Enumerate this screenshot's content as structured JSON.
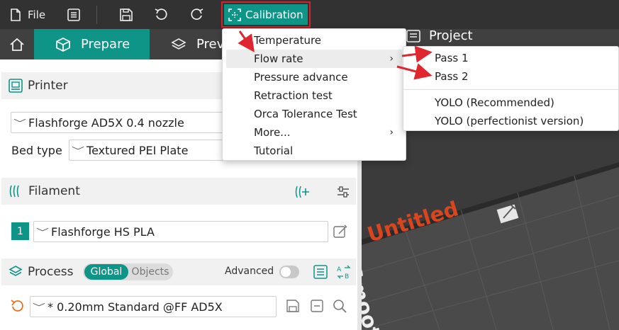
{
  "toolbar": {
    "file_label": "File",
    "calibration_label": "Calibration",
    "accent_color": "#0f9488",
    "highlight_color": "#d6222a"
  },
  "tabs": {
    "prepare_label": "Prepare",
    "preview_label": "Prev",
    "project_label": "Project"
  },
  "printer": {
    "section_title": "Printer",
    "preset": "Flashforge AD5X 0.4 nozzle",
    "bed_type_label": "Bed type",
    "bed_type_value": "Textured PEI Plate"
  },
  "filament": {
    "section_title": "Filament",
    "slot_number": "1",
    "preset": "Flashforge HS PLA"
  },
  "process": {
    "section_title": "Process",
    "global_label": "Global",
    "objects_label": "Objects",
    "advanced_label": "Advanced",
    "preset": "* 0.20mm Standard @FF AD5X"
  },
  "viewport": {
    "plate_name": "Untitled",
    "bed_text": "Smoot"
  },
  "calibration_menu": {
    "items": [
      {
        "label": "Temperature"
      },
      {
        "label": "Flow rate",
        "has_submenu": true
      },
      {
        "label": "Pressure advance"
      },
      {
        "label": "Retraction test"
      },
      {
        "label": "Orca Tolerance Test"
      },
      {
        "label": "More...",
        "has_submenu": true
      },
      {
        "label": "Tutorial"
      }
    ],
    "submenu_arrow": "›"
  },
  "flow_rate_submenu": {
    "items": [
      {
        "label": "Pass 1"
      },
      {
        "label": "Pass 2"
      },
      {
        "label": "YOLO (Recommended)"
      },
      {
        "label": "YOLO (perfectionist version)"
      }
    ]
  }
}
